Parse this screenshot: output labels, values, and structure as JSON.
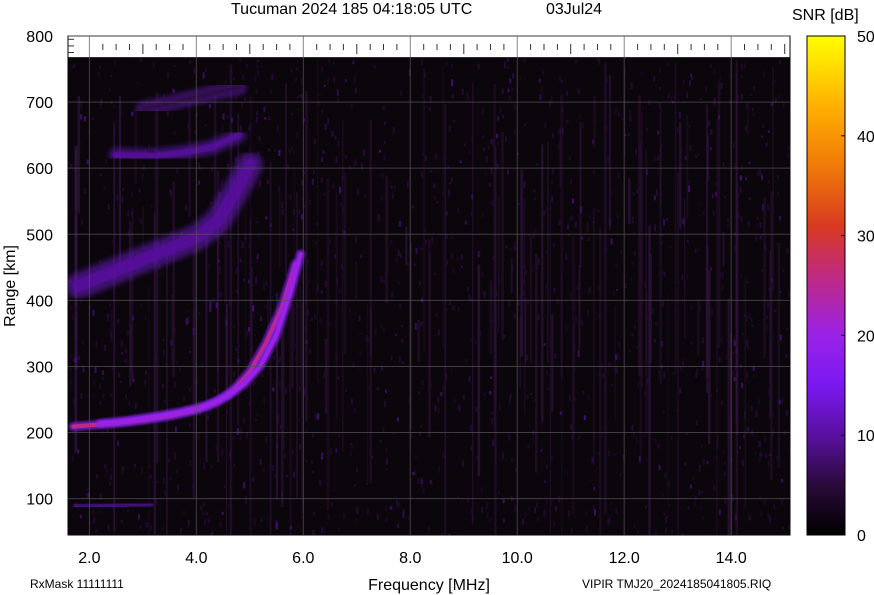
{
  "chart_data": {
    "type": "heatmap",
    "title": "Tucuman 2024 185 04:18:05 UTC",
    "date": "03Jul24",
    "xlabel": "Frequency [MHz]",
    "ylabel": "Range [km]",
    "x_ticks": [
      "2.0",
      "4.0",
      "6.0",
      "8.0",
      "10.0",
      "12.0",
      "14.0"
    ],
    "y_ticks": [
      "100",
      "200",
      "300",
      "400",
      "500",
      "600",
      "700",
      "800"
    ],
    "xlim": [
      1.6,
      15.1
    ],
    "ylim": [
      45,
      800
    ],
    "data_range_top_km": 768,
    "grid": true,
    "colorbar": {
      "label": "SNR [dB]",
      "range": [
        0,
        50
      ],
      "ticks": [
        "0",
        "10",
        "20",
        "30",
        "40",
        "50"
      ]
    },
    "traces": [
      {
        "kind": "o-trace",
        "points": [
          [
            1.7,
            209
          ],
          [
            2.0,
            211
          ],
          [
            2.5,
            214
          ],
          [
            3.0,
            219
          ],
          [
            3.5,
            225
          ],
          [
            4.0,
            234
          ],
          [
            4.4,
            247
          ],
          [
            4.7,
            265
          ],
          [
            5.0,
            292
          ],
          [
            5.3,
            335
          ],
          [
            5.6,
            390
          ],
          [
            5.85,
            455
          ]
        ],
        "snr_peak_db": 30
      },
      {
        "kind": "x-trace",
        "points": [
          [
            2.2,
            214
          ],
          [
            2.7,
            218
          ],
          [
            3.2,
            224
          ],
          [
            3.7,
            231
          ],
          [
            4.2,
            241
          ],
          [
            4.6,
            256
          ],
          [
            4.9,
            274
          ],
          [
            5.2,
            301
          ],
          [
            5.5,
            348
          ],
          [
            5.75,
            410
          ],
          [
            5.95,
            470
          ]
        ],
        "snr_peak_db": 23
      },
      {
        "kind": "multi-hop-band",
        "points": [
          [
            1.8,
            422
          ],
          [
            2.5,
            445
          ],
          [
            3.0,
            462
          ],
          [
            3.5,
            478
          ],
          [
            4.0,
            495
          ],
          [
            4.4,
            520
          ],
          [
            4.7,
            560
          ],
          [
            5.0,
            605
          ]
        ],
        "snr_peak_db": 12
      },
      {
        "kind": "multi-hop-band",
        "points": [
          [
            2.5,
            620
          ],
          [
            3.2,
            618
          ],
          [
            3.8,
            624
          ],
          [
            4.3,
            632
          ],
          [
            4.8,
            650
          ]
        ],
        "snr_peak_db": 9
      },
      {
        "kind": "multi-hop-band",
        "points": [
          [
            3.0,
            690
          ],
          [
            3.6,
            700
          ],
          [
            4.2,
            712
          ],
          [
            4.8,
            722
          ]
        ],
        "snr_peak_db": 7
      },
      {
        "kind": "interference-band",
        "points": [
          [
            10.4,
            120
          ],
          [
            10.4,
            760
          ]
        ],
        "snr_peak_db": 9
      },
      {
        "kind": "ground-echo",
        "points": [
          [
            1.7,
            88
          ],
          [
            2.5,
            90
          ],
          [
            3.2,
            92
          ]
        ],
        "snr_peak_db": 7
      }
    ]
  },
  "footer": {
    "left": "RxMask 11111111",
    "right": "VIPIR  TMJ20_2024185041805.RIQ"
  },
  "colors": {
    "plot_background": "#0b060c",
    "grid": "#555555",
    "colormap": [
      "#000000",
      "#2a0a3a",
      "#5a10a0",
      "#7a18f0",
      "#9a22e8",
      "#c02a80",
      "#d83a20",
      "#f07a08",
      "#ffb000",
      "#ffff00"
    ]
  }
}
